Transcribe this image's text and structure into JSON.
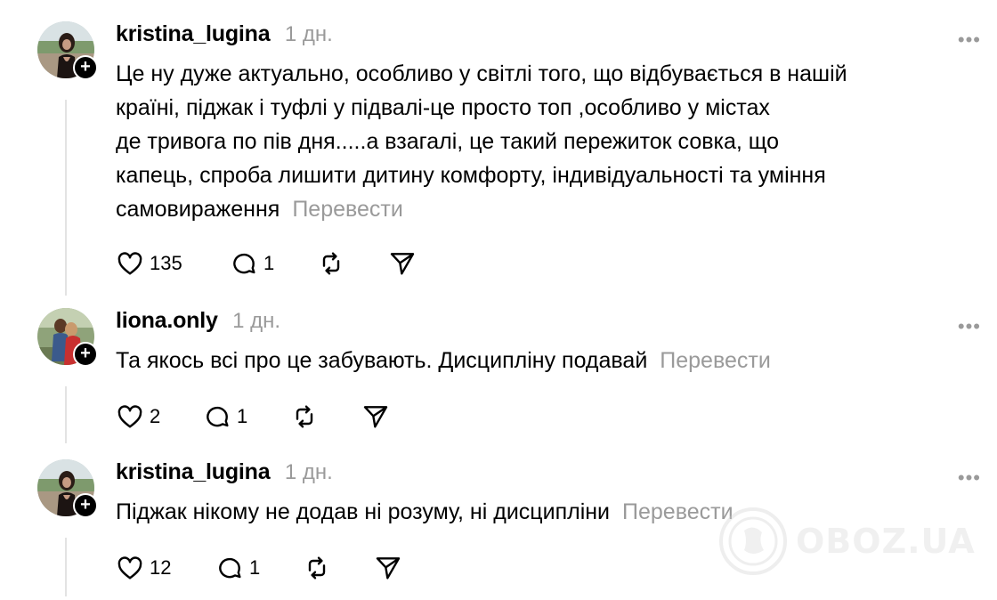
{
  "comments": [
    {
      "username": "kristina_lugina",
      "time": "1 дн.",
      "lines": [
        "Це ну дуже актуально, особливо у світлі того, що відбувається в нашій",
        "країні, піджак і туфлі у підвалі-це просто топ ,особливо у містах",
        "де тривога по пів дня.....а взагалі, це такий пережиток совка, що",
        "капець, спроба лишити дитину комфорту, індивідуальності та уміння",
        "самовираження"
      ],
      "translate": "Перевести",
      "likes": "135",
      "replies": "1"
    },
    {
      "username": "liona.only",
      "time": "1 дн.",
      "lines": [
        "Та якось всі про це забувають. Дисципліну подавай"
      ],
      "translate": "Перевести",
      "likes": "2",
      "replies": "1"
    },
    {
      "username": "kristina_lugina",
      "time": "1 дн.",
      "lines": [
        "Піджак нікому не додав ні розуму, ні дисципліни"
      ],
      "translate": "Перевести",
      "likes": "12",
      "replies": "1"
    }
  ],
  "more_label": "•••",
  "follow_label": "+",
  "watermark": "OBOZ.UA",
  "colors": {
    "secondary_text": "#9a9a9a",
    "thread_line": "#e3e3e3"
  }
}
